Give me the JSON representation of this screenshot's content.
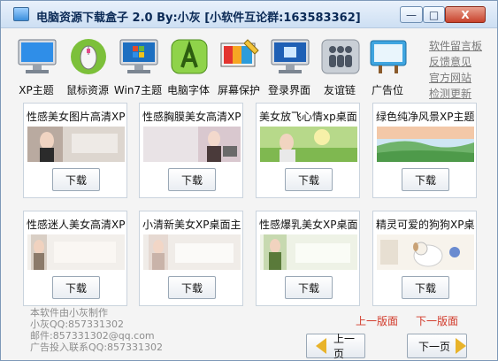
{
  "window": {
    "title": "电脑资源下载盒子 2.0 By:小灰 [小软件互论群:163583362]",
    "minimize_glyph": "—",
    "maximize_glyph": "□",
    "close_glyph": "X"
  },
  "toolbar": {
    "items": [
      {
        "label": "XP主题",
        "icon": "monitor-icon"
      },
      {
        "label": "鼠标资源",
        "icon": "mouse-icon"
      },
      {
        "label": "Win7主题",
        "icon": "windows-monitor-icon"
      },
      {
        "label": "电脑字体",
        "icon": "font-letter-a-icon"
      },
      {
        "label": "屏幕保护",
        "icon": "screensaver-icon"
      },
      {
        "label": "登录界面",
        "icon": "login-screen-icon"
      },
      {
        "label": "友谊链",
        "icon": "people-icon"
      },
      {
        "label": "广告位",
        "icon": "billboard-icon"
      }
    ]
  },
  "side_links": [
    "软件留言板",
    "反馈意见",
    "官方网站",
    "检测更新"
  ],
  "cards": [
    {
      "title": "性感美女图片高清XP",
      "download": "下载"
    },
    {
      "title": "性感胸膜美女高清XP",
      "download": "下载"
    },
    {
      "title": "美女放飞心情xp桌面",
      "download": "下载"
    },
    {
      "title": "绿色纯净风景XP主题",
      "download": "下载"
    },
    {
      "title": "性感迷人美女高清XP",
      "download": "下载"
    },
    {
      "title": "小清新美女XP桌面主",
      "download": "下载"
    },
    {
      "title": "性感爆乳美女XP桌面",
      "download": "下载"
    },
    {
      "title": "精灵可爱的狗狗XP桌",
      "download": "下载"
    }
  ],
  "footer": {
    "lines": [
      "本软件由小灰制作",
      "小灰QQ:857331302",
      "邮件:857331302@qq.com",
      "广告投入联系QQ:857331302"
    ],
    "prev_page_link": "上一版面",
    "next_page_link": "下一版面",
    "prev_button": "上一页",
    "next_button": "下一页"
  },
  "colors": {
    "accent_red": "#d23a2a",
    "title_text": "#0b2a56",
    "arrow_yellow": "#e8b32a"
  }
}
